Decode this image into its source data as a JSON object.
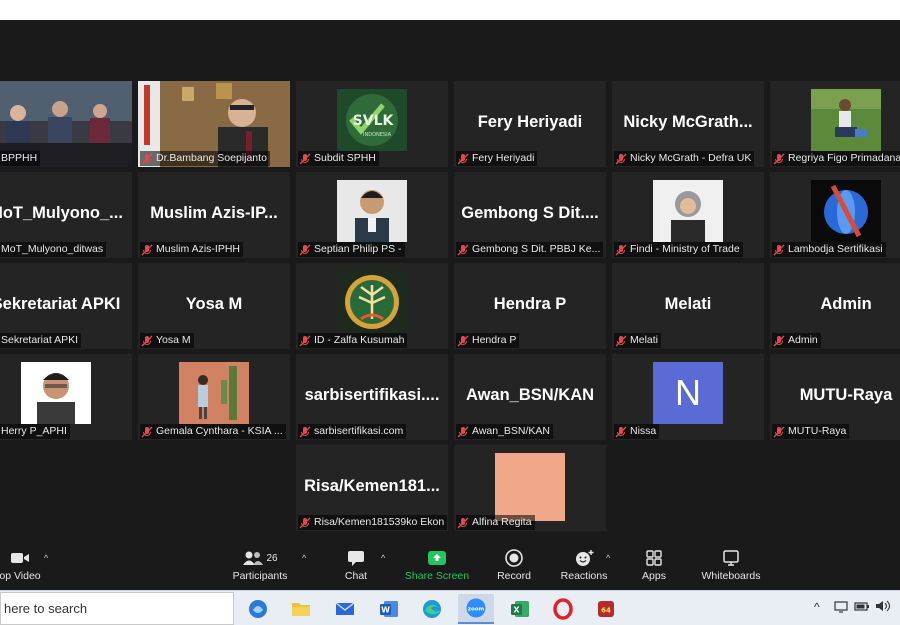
{
  "participants": [
    {
      "name": "",
      "label": "BPPHH",
      "muted": false
    },
    {
      "name": "",
      "label": "Dr.Bambang Soepijanto",
      "muted": true
    },
    {
      "name": "",
      "label": "Subdit SPHH",
      "muted": true
    },
    {
      "name": "Fery Heriyadi",
      "label": "Fery Heriyadi",
      "muted": true
    },
    {
      "name": "Nicky  McGrath...",
      "label": "Nicky McGrath - Defra UK",
      "muted": true
    },
    {
      "name": "",
      "label": "Regriya Figo Primadana",
      "muted": true
    },
    {
      "name": "MoT_Mulyono_...",
      "label": "MoT_Mulyono_ditwas",
      "muted": false
    },
    {
      "name": "Muslim  Azis-IP...",
      "label": "Muslim Azis-IPHH",
      "muted": true
    },
    {
      "name": "",
      "label": "Septian Philip PS  -",
      "muted": true
    },
    {
      "name": "Gembong  S  Dit....",
      "label": "Gembong S Dit. PBBJ Ke...",
      "muted": true
    },
    {
      "name": "",
      "label": "Findi - Ministry of Trade",
      "muted": true
    },
    {
      "name": "",
      "label": "Lambodja Sertifikasi",
      "muted": true
    },
    {
      "name": "Sekretariat APKI",
      "label": "Sekretariat APKI",
      "muted": false
    },
    {
      "name": "Yosa M",
      "label": "Yosa M",
      "muted": true
    },
    {
      "name": "",
      "label": "ID - Zalfa Kusumah",
      "muted": true
    },
    {
      "name": "Hendra P",
      "label": "Hendra P",
      "muted": true
    },
    {
      "name": "Melati",
      "label": "Melati",
      "muted": true
    },
    {
      "name": "Admin",
      "label": "Admin",
      "muted": true
    },
    {
      "name": "",
      "label": "Herry P_APHI",
      "muted": false
    },
    {
      "name": "",
      "label": "Gemala Cynthara - KSIA ...",
      "muted": true
    },
    {
      "name": "sarbisertifikasi....",
      "label": "sarbisertifikasi.com",
      "muted": true
    },
    {
      "name": "Awan_BSN/KAN",
      "label": "Awan_BSN/KAN",
      "muted": true
    },
    {
      "name": "",
      "label": "Nissa",
      "muted": true
    },
    {
      "name": "MUTU-Raya",
      "label": "MUTU-Raya",
      "muted": true
    },
    {
      "name": "Risa/Kemen181...",
      "label": "Risa/Kemen181539ko Ekon",
      "muted": true
    },
    {
      "name": "",
      "label": "Alfina Regita",
      "muted": true
    }
  ],
  "avatar_letter": "N",
  "avatar_color": "#5b6bd5",
  "svlk_text": "SVLK",
  "svlk_sub": "INDONESIA",
  "toolbar": {
    "stop_video": "op Video",
    "participants": "Participants",
    "participants_count": "26",
    "chat": "Chat",
    "share_screen": "Share Screen",
    "record": "Record",
    "reactions": "Reactions",
    "apps": "Apps",
    "whiteboards": "Whiteboards"
  },
  "colors": {
    "share_green": "#22c55e",
    "muted_red": "#e5484d",
    "active_speaker": "#d6e94a",
    "gallery_bg": "#1a1a1a",
    "tile_bg": "#242424"
  },
  "taskbar": {
    "search_placeholder": " here to search",
    "opera_badge": "64"
  }
}
